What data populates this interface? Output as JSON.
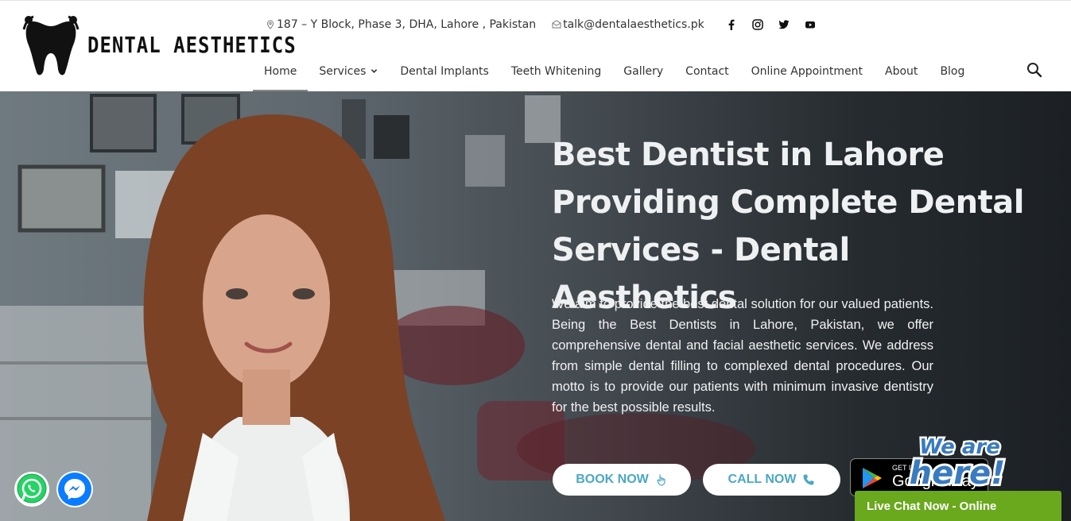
{
  "brand": {
    "name": "DENTAL AESTHETICS",
    "logo_icon": "tooth-logo-icon"
  },
  "topbar": {
    "address": "187 – Y Block, Phase 3, DHA, Lahore , Pakistan",
    "email": "talk@dentalaesthetics.pk",
    "social": [
      "facebook-icon",
      "instagram-icon",
      "twitter-icon",
      "youtube-icon"
    ]
  },
  "nav": {
    "items": [
      {
        "label": "Home",
        "active": true
      },
      {
        "label": "Services",
        "dropdown": true
      },
      {
        "label": "Dental Implants"
      },
      {
        "label": "Teeth Whitening"
      },
      {
        "label": "Gallery"
      },
      {
        "label": "Contact"
      },
      {
        "label": "Online Appointment"
      },
      {
        "label": "About"
      },
      {
        "label": "Blog"
      }
    ],
    "search_icon": "search-icon"
  },
  "hero": {
    "title": "Best Dentist in Lahore Providing Complete Dental Services - Dental Aesthetics",
    "text": "We aim to provide the best dental solution for our valued patients. Being the Best Dentists in Lahore, Pakistan, we offer comprehensive dental and facial aesthetic services. We address from simple dental filling to complexed dental procedures. Our motto is to provide our patients with minimum invasive dentistry for the best possible results.",
    "book_label": "BOOK NOW",
    "call_label": "CALL NOW",
    "gplay_small": "GET IT ON",
    "gplay_big": "Google Play"
  },
  "chat": {
    "badge_line1": "We are",
    "badge_line2": "here!",
    "live_label": "Live Chat Now - Online"
  },
  "colors": {
    "accent": "#4aa8c4",
    "chat_green": "#6aa81e",
    "whatsapp": "#25d366",
    "messenger": "#0a7cff"
  }
}
